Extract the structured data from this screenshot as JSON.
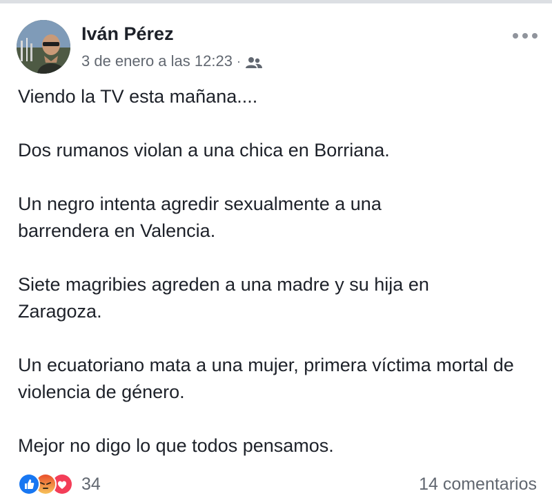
{
  "post": {
    "author": "Iván Pérez",
    "timestamp": "3 de enero a las 12:23",
    "separator": "·",
    "audience_icon": "friends-icon",
    "more_icon": "more-options-icon",
    "paragraphs": [
      "Viendo la TV esta mañana....",
      "Dos rumanos violan a una chica en Borriana.",
      "Un negro intenta agredir sexualmente a una barrendera en Valencia.",
      "Siete magribies agreden a una madre y su hija en Zaragoza.",
      "Un ecuatoriano mata a una mujer, primera víctima mortal de violencia de género.",
      "Mejor no digo lo que todos pensamos."
    ]
  },
  "footer": {
    "reactions": [
      "like",
      "angry",
      "love"
    ],
    "reaction_count": "34",
    "comments": "14 comentarios"
  },
  "colors": {
    "text": "#1d2129",
    "secondary": "#616770",
    "like": "#1877f2",
    "angry": "#f0743a",
    "love": "#f33e58"
  }
}
